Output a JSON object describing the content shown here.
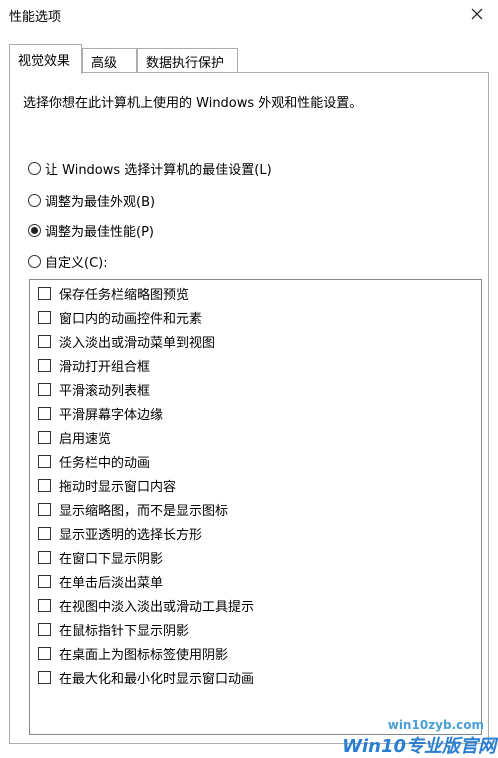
{
  "window": {
    "title": "性能选项"
  },
  "tabs": [
    {
      "label": "视觉效果",
      "active": true
    },
    {
      "label": "高级",
      "active": false
    },
    {
      "label": "数据执行保护",
      "active": false
    }
  ],
  "panel": {
    "description": "选择你想在此计算机上使用的 Windows 外观和性能设置。",
    "radios": [
      {
        "label": "让 Windows 选择计算机的最佳设置(L)",
        "checked": false
      },
      {
        "label": "调整为最佳外观(B)",
        "checked": false
      },
      {
        "label": "调整为最佳性能(P)",
        "checked": true
      },
      {
        "label": "自定义(C):",
        "checked": false
      }
    ],
    "options": [
      {
        "label": "保存任务栏缩略图预览",
        "checked": false
      },
      {
        "label": "窗口内的动画控件和元素",
        "checked": false
      },
      {
        "label": "淡入淡出或滑动菜单到视图",
        "checked": false
      },
      {
        "label": "滑动打开组合框",
        "checked": false
      },
      {
        "label": "平滑滚动列表框",
        "checked": false
      },
      {
        "label": "平滑屏幕字体边缘",
        "checked": false
      },
      {
        "label": "启用速览",
        "checked": false
      },
      {
        "label": "任务栏中的动画",
        "checked": false
      },
      {
        "label": "拖动时显示窗口内容",
        "checked": false
      },
      {
        "label": "显示缩略图，而不是显示图标",
        "checked": false
      },
      {
        "label": "显示亚透明的选择长方形",
        "checked": false
      },
      {
        "label": "在窗口下显示阴影",
        "checked": false
      },
      {
        "label": "在单击后淡出菜单",
        "checked": false
      },
      {
        "label": "在视图中淡入淡出或滑动工具提示",
        "checked": false
      },
      {
        "label": "在鼠标指针下显示阴影",
        "checked": false
      },
      {
        "label": "在桌面上为图标标签使用阴影",
        "checked": false
      },
      {
        "label": "在最大化和最小化时显示窗口动画",
        "checked": false
      }
    ]
  },
  "watermark": {
    "url": "win10zyb.com",
    "brand": "Win10专业版官网"
  },
  "icons": {
    "close": "close-icon"
  }
}
